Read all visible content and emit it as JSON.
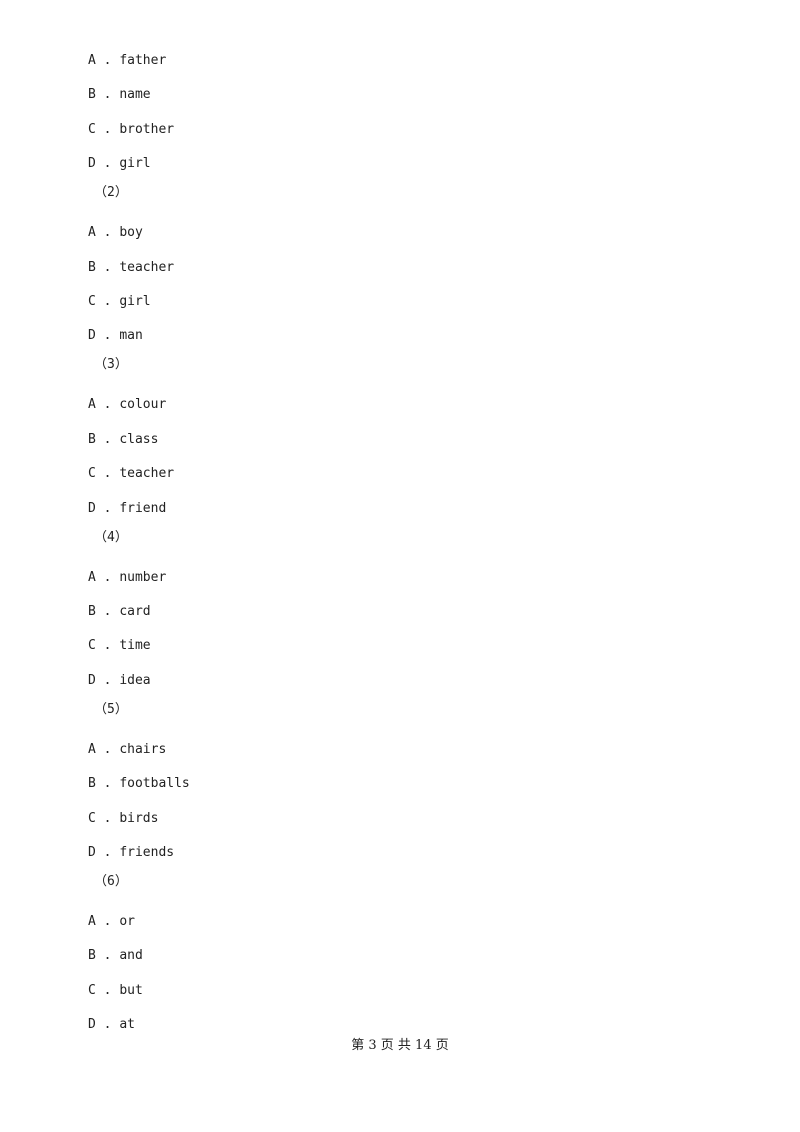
{
  "groups": [
    {
      "label": "",
      "options": [
        {
          "letter": "A",
          "text": "father"
        },
        {
          "letter": "B",
          "text": "name"
        },
        {
          "letter": "C",
          "text": "brother"
        },
        {
          "letter": "D",
          "text": "girl"
        }
      ]
    },
    {
      "label": "（2）",
      "options": [
        {
          "letter": "A",
          "text": "boy"
        },
        {
          "letter": "B",
          "text": "teacher"
        },
        {
          "letter": "C",
          "text": "girl"
        },
        {
          "letter": "D",
          "text": "man"
        }
      ]
    },
    {
      "label": "（3）",
      "options": [
        {
          "letter": "A",
          "text": "colour"
        },
        {
          "letter": "B",
          "text": "class"
        },
        {
          "letter": "C",
          "text": "teacher"
        },
        {
          "letter": "D",
          "text": "friend"
        }
      ]
    },
    {
      "label": "（4）",
      "options": [
        {
          "letter": "A",
          "text": "number"
        },
        {
          "letter": "B",
          "text": "card"
        },
        {
          "letter": "C",
          "text": "time"
        },
        {
          "letter": "D",
          "text": "idea"
        }
      ]
    },
    {
      "label": "（5）",
      "options": [
        {
          "letter": "A",
          "text": "chairs"
        },
        {
          "letter": "B",
          "text": "footballs"
        },
        {
          "letter": "C",
          "text": "birds"
        },
        {
          "letter": "D",
          "text": "friends"
        }
      ]
    },
    {
      "label": "（6）",
      "options": [
        {
          "letter": "A",
          "text": "or"
        },
        {
          "letter": "B",
          "text": "and"
        },
        {
          "letter": "C",
          "text": "but"
        },
        {
          "letter": "D",
          "text": "at"
        }
      ]
    }
  ],
  "footer": {
    "text": "第 3 页 共 14 页"
  }
}
